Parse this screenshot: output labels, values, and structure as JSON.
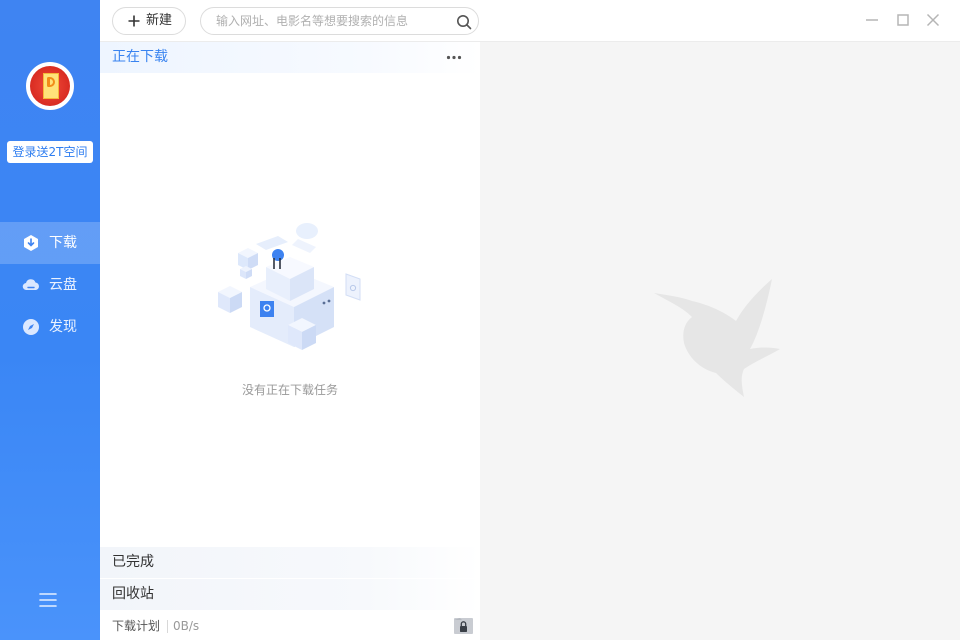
{
  "sidebar": {
    "avatar": {
      "icon": "user-avatar"
    },
    "login_label": "登录送2T空间",
    "nav": [
      {
        "label": "下载",
        "icon": "download-icon",
        "active": true
      },
      {
        "label": "云盘",
        "icon": "cloud-icon",
        "active": false
      },
      {
        "label": "发现",
        "icon": "compass-icon",
        "active": false
      }
    ],
    "menu_icon": "hamburger-menu-icon"
  },
  "toolbar": {
    "new_label": "新建",
    "search_placeholder": "输入网址、电影名等想要搜索的信息",
    "search_value": ""
  },
  "window_controls": [
    "minimize-icon",
    "maximize-icon",
    "close-icon"
  ],
  "downloads": {
    "downloading_title": "正在下载",
    "more_icon": "more-dots-icon",
    "empty_text": "没有正在下载任务",
    "completed_title": "已完成",
    "recycle_title": "回收站"
  },
  "footer": {
    "plan_label": "下载计划",
    "speed": "0B/s",
    "lock_icon": "lock-icon"
  },
  "colors": {
    "accent": "#3a84f0",
    "sidebar_top": "#3f84f2",
    "sidebar_bottom": "#4a93fb",
    "right_bg": "#f5f5f5"
  }
}
